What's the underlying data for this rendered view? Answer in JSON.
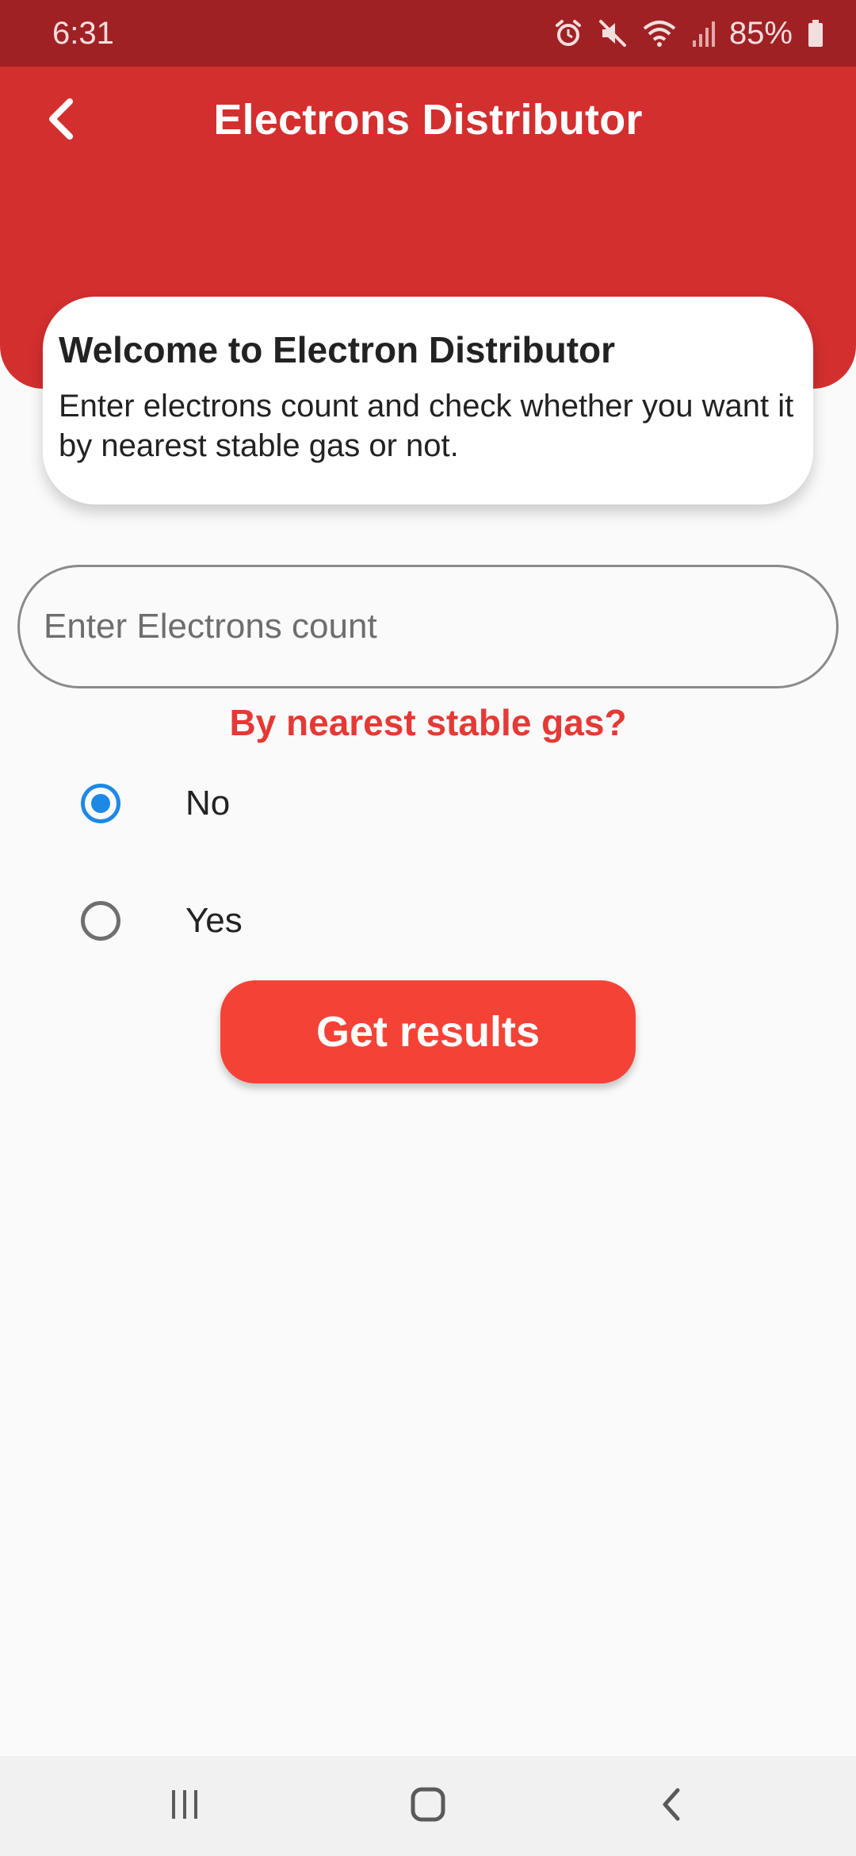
{
  "status_bar": {
    "time": "6:31",
    "battery_percent": "85%",
    "icons": [
      "alarm-icon",
      "mute-icon",
      "wifi-icon",
      "signal-icon",
      "battery-icon"
    ]
  },
  "header": {
    "title": "Electrons Distributor",
    "back_icon": "back-arrow-icon",
    "background_color": "#d32f2f"
  },
  "welcome_card": {
    "title": "Welcome to Electron Distributor",
    "text": "Enter electrons count and check whether you want it by nearest stable gas or not."
  },
  "count_input": {
    "placeholder": "Enter Electrons count",
    "value": ""
  },
  "question": {
    "label": "By nearest stable gas?",
    "color": "#e53935"
  },
  "options": [
    {
      "label": "No",
      "selected": true
    },
    {
      "label": "Yes",
      "selected": false
    }
  ],
  "action_button": {
    "label": "Get results",
    "color": "#f44336"
  },
  "nav_bar": {
    "icons": [
      "recent-apps-icon",
      "home-icon",
      "nav-back-icon"
    ]
  }
}
